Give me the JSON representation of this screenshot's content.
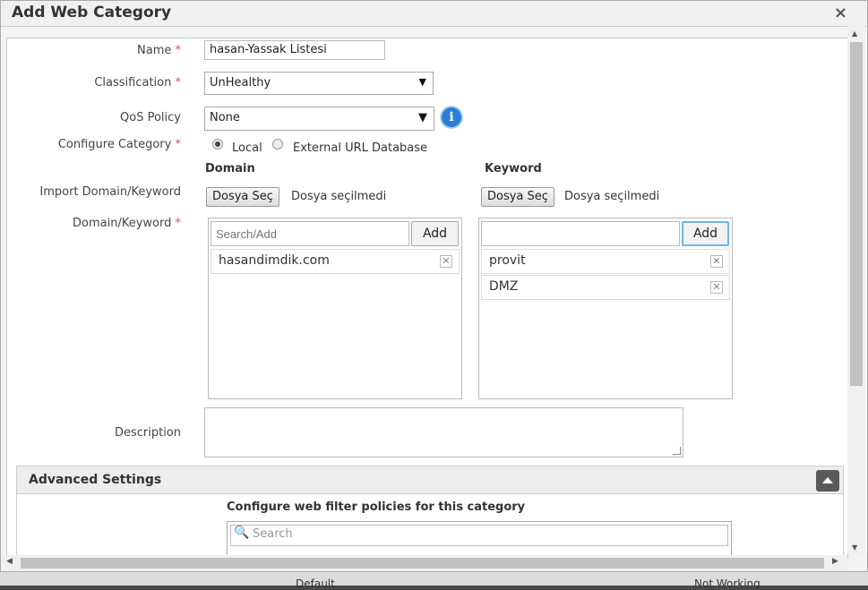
{
  "dialog": {
    "title": "Add Web Category",
    "close_label": "×"
  },
  "form": {
    "name": {
      "label": "Name",
      "value": "hasan-Yassak Listesi"
    },
    "classification": {
      "label": "Classification",
      "selected": "UnHealthy"
    },
    "qos_policy": {
      "label": "QoS Policy",
      "selected": "None"
    },
    "configure_category": {
      "label": "Configure Category",
      "option_local": "Local",
      "option_external": "External URL Database",
      "selected": "Local"
    },
    "domain_header": "Domain",
    "keyword_header": "Keyword",
    "import": {
      "label": "Import Domain/Keyword",
      "button": "Dosya Seç",
      "status": "Dosya seçilmedi"
    },
    "domain_keyword_label": "Domain/Keyword",
    "domain_list": {
      "placeholder": "Search/Add",
      "add_label": "Add",
      "items": [
        "hasandimdik.com"
      ]
    },
    "keyword_list": {
      "placeholder": "",
      "add_label": "Add",
      "items": [
        "provit",
        "DMZ"
      ]
    },
    "description": {
      "label": "Description",
      "value": ""
    },
    "required_mark": "*"
  },
  "advanced": {
    "title": "Advanced Settings",
    "subtitle": "Configure web filter policies for this category",
    "search_placeholder": "Search"
  },
  "background": {
    "left_text": "Default",
    "right_text": "Not Working"
  }
}
